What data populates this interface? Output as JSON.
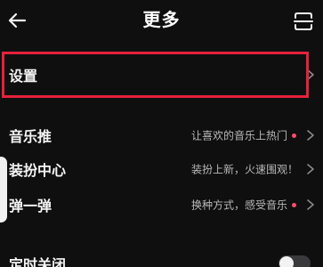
{
  "header": {
    "title": "更多",
    "back_icon": "arrow-left-icon",
    "right_icon": "scan-icon"
  },
  "rows": [
    {
      "label": "设置"
    },
    {
      "label": "音乐推",
      "sub": "让喜欢的音乐上热门",
      "dot": true
    },
    {
      "label": "装扮中心",
      "sub": "装扮上新，火速围观！"
    },
    {
      "label": "弹一弹",
      "sub": "换种方式，感受音乐",
      "dot": true
    },
    {
      "label": "定时关闭",
      "toggle": "off"
    }
  ],
  "colors": {
    "background": "#0f0f10",
    "highlight": "#e6223a",
    "dot": "#ff4b6e"
  }
}
